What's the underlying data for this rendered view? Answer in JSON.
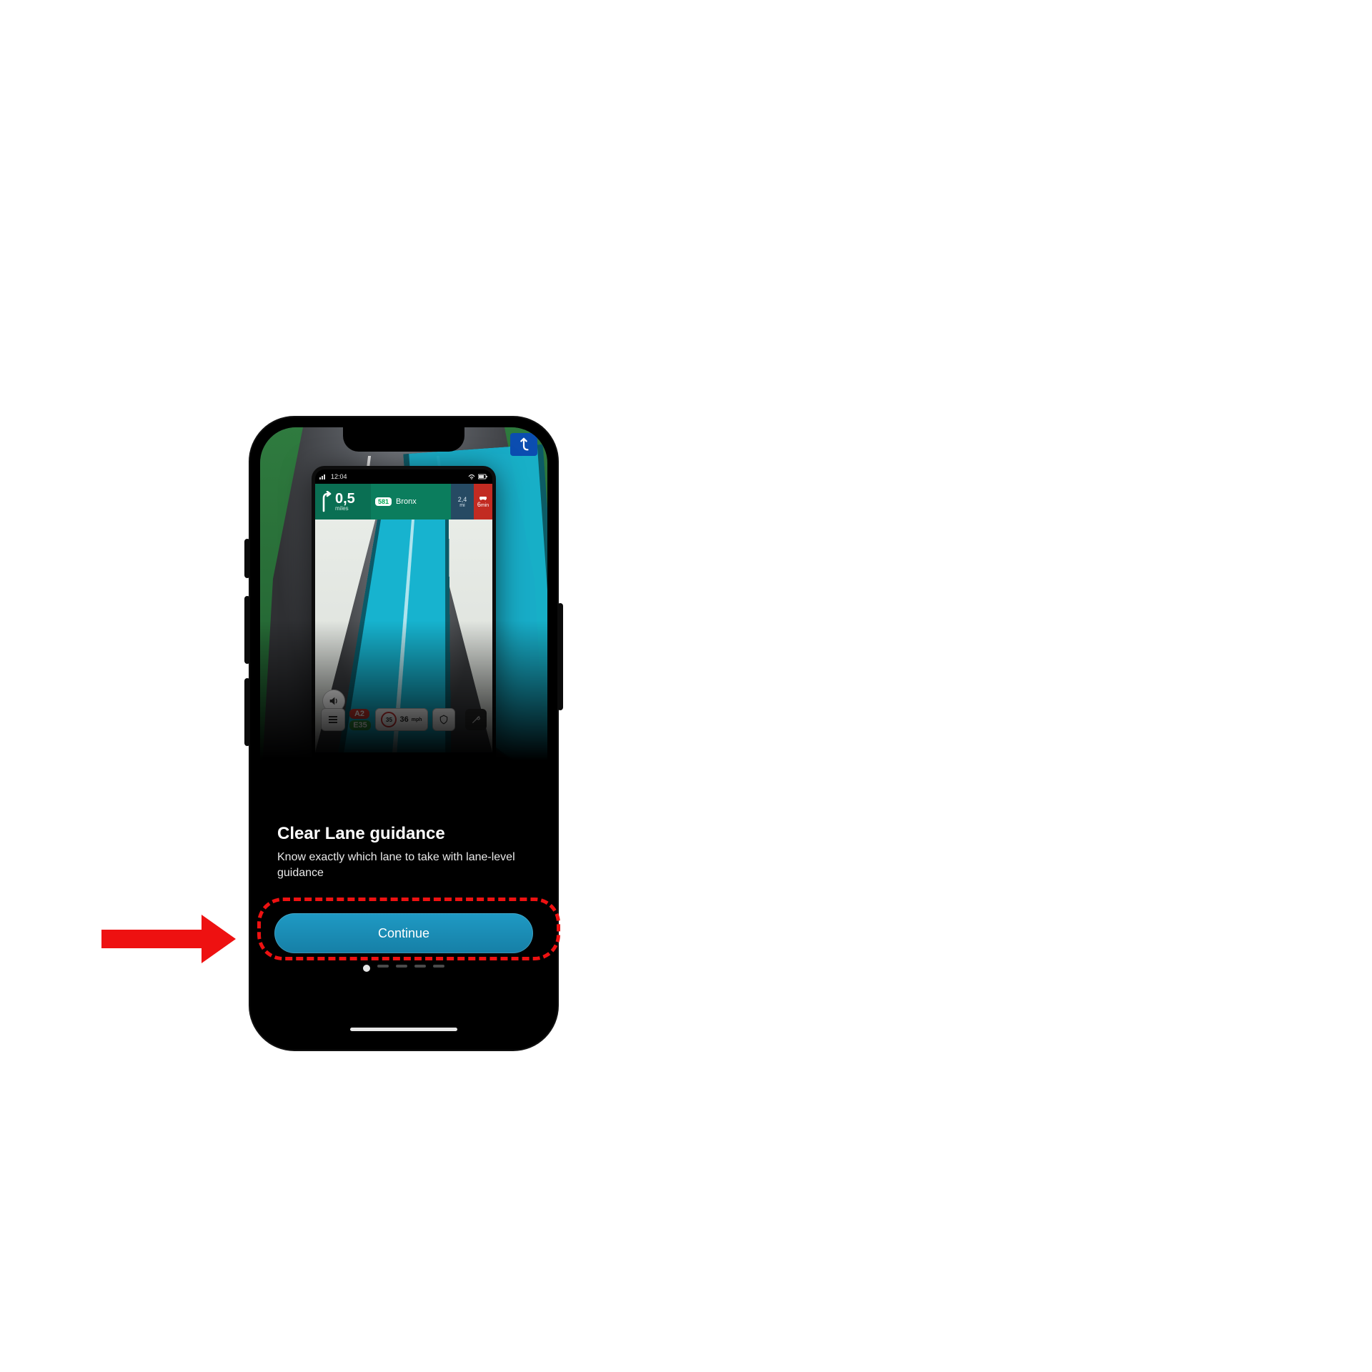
{
  "colors": {
    "accent": "#1a8fb9",
    "annotation": "#e11"
  },
  "hero_sign": {
    "icon": "merge-right-icon"
  },
  "nav_device": {
    "status": {
      "time": "12:04",
      "carrier_icon": "signal-icon",
      "wifi_icon": "wifi-icon",
      "battery_icon": "battery-icon"
    },
    "topbar": {
      "turn_icon": "turn-right-icon",
      "distance_value": "0,5",
      "distance_unit": "miles",
      "road_shield": "581",
      "road_name": "Bronx",
      "eta_value": "2,4",
      "eta_unit": "mi",
      "traffic_value": "6",
      "traffic_unit": "min",
      "traffic_icon": "car-icon"
    },
    "map_controls": {
      "speaker_icon": "speaker-icon"
    },
    "bottom": {
      "menu_icon": "menu-icon",
      "route_badge_1": "A2",
      "route_badge_2": "E35",
      "speed_limit": "35",
      "speed_current": "36",
      "speed_unit": "mph",
      "camera_icon": "shield-icon",
      "tools_icon": "tools-icon"
    },
    "softkeys": {
      "recent_icon": "recent-apps-icon",
      "home_icon": "home-icon",
      "back_icon": "back-icon"
    }
  },
  "onboarding": {
    "title": "Clear Lane guidance",
    "body": "Know exactly which lane to take with lane-level guidance",
    "button_label": "Continue",
    "page_count": 5,
    "page_active_index": 0
  }
}
